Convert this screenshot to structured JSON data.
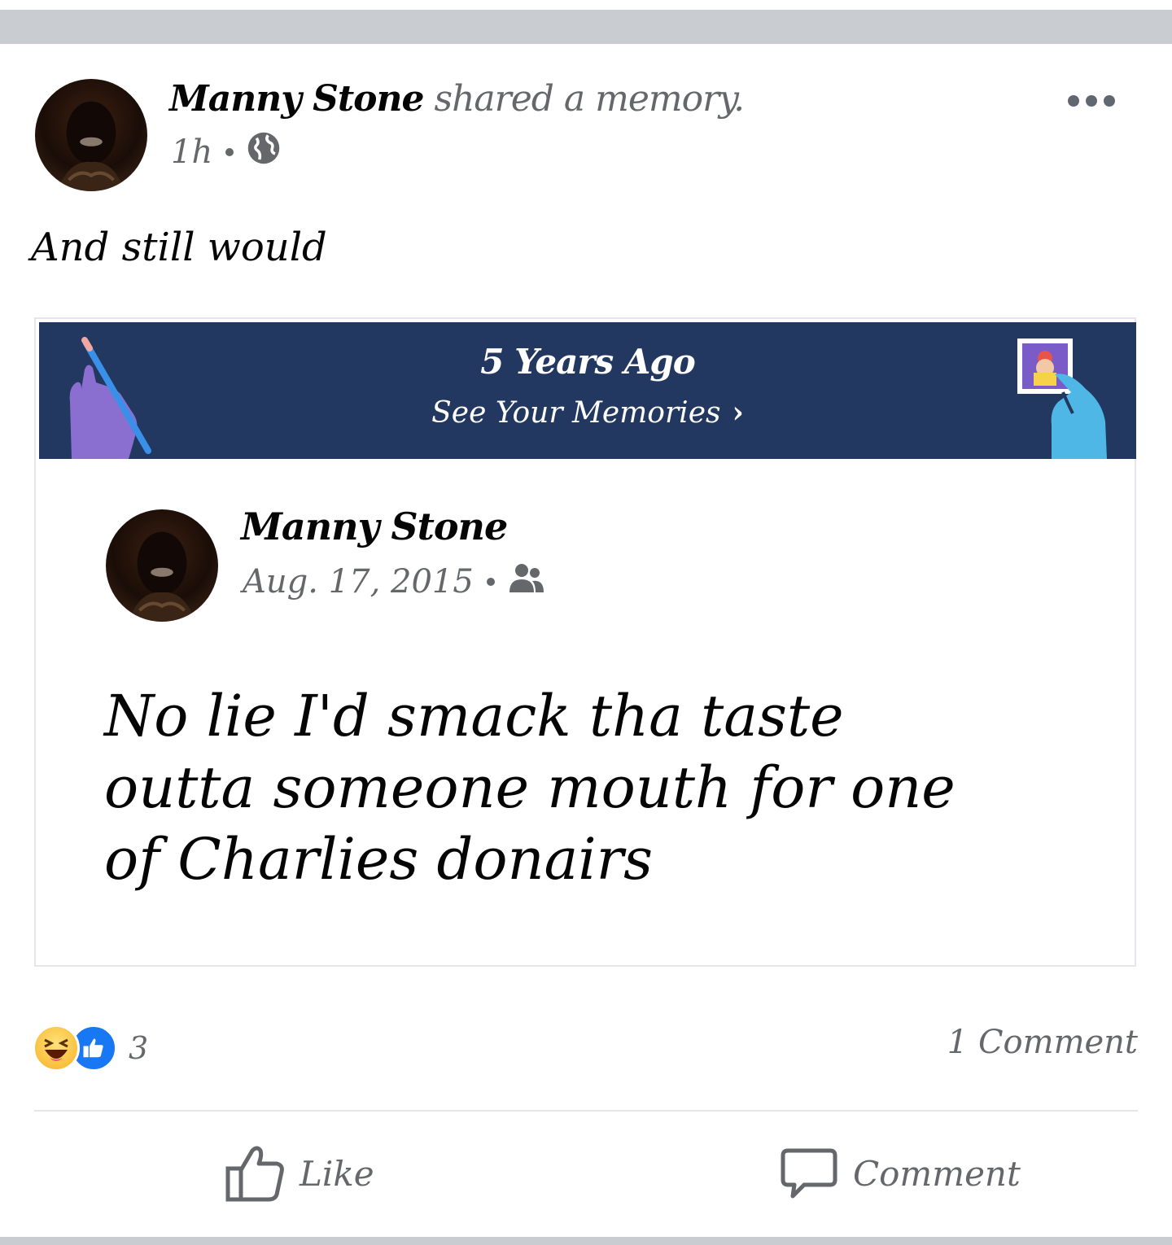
{
  "post": {
    "author": "Manny Stone",
    "action_text": "shared a memory.",
    "time": "1h",
    "privacy_icon": "globe-icon",
    "text": "And still would"
  },
  "memory": {
    "banner_title": "5 Years Ago",
    "banner_link": "See Your Memories",
    "colors": {
      "banner_bg": "#233861",
      "hand_left": "#8b6fd0",
      "hand_right": "#4fb7e6"
    },
    "original_post": {
      "author": "Manny Stone",
      "date": "Aug. 17, 2015",
      "audience_icon": "friends-icon",
      "text": "No lie I'd smack tha taste outta someone mouth for one of Charlies donairs"
    }
  },
  "engagement": {
    "reaction_icons": [
      "haha-icon",
      "like-icon"
    ],
    "reaction_count": "3",
    "comment_count": "1 Comment"
  },
  "actions": {
    "like_label": "Like",
    "comment_label": "Comment"
  }
}
